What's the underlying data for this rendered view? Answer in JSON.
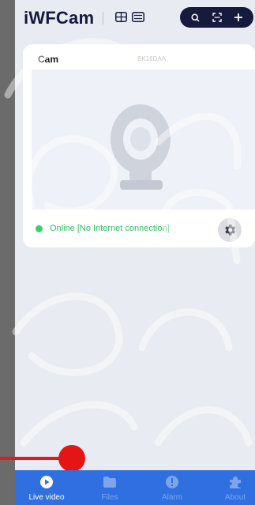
{
  "header": {
    "app_title": "iWFCam",
    "icons": [
      "grid-view-icon",
      "multi-view-icon"
    ],
    "pill_icons": [
      "search-icon",
      "scan-icon",
      "add-icon"
    ]
  },
  "camera_card": {
    "name": "Cam",
    "device_id": "BK16DAA",
    "status_text": "Online [No Internet connection]",
    "status_color": "#35d36b"
  },
  "bottom_nav": {
    "items": [
      {
        "label": "Live video",
        "icon": "live-video-icon",
        "active": true
      },
      {
        "label": "Files",
        "icon": "files-icon",
        "active": false
      },
      {
        "label": "Alarm",
        "icon": "alarm-icon",
        "active": false
      },
      {
        "label": "About",
        "icon": "puzzle-icon",
        "active": false
      }
    ]
  },
  "colors": {
    "nav_background": "#2f6fe0",
    "header_pill": "#161a3c",
    "annotation_red": "#e51515"
  }
}
